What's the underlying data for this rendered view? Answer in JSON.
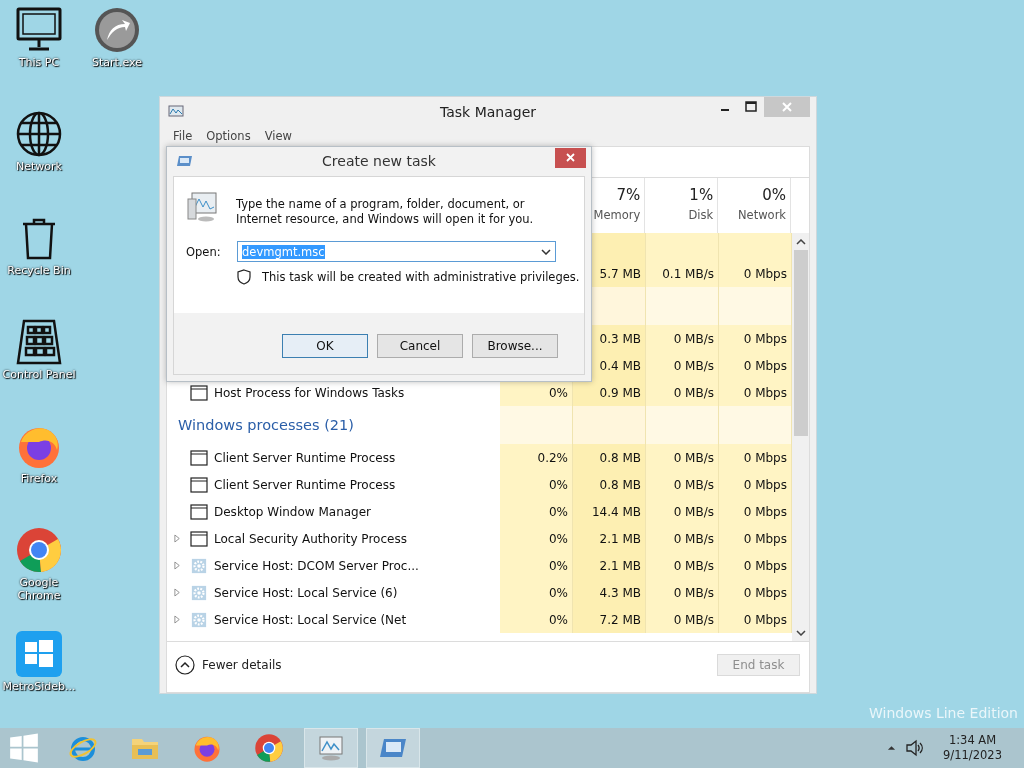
{
  "desktop": {
    "icons": [
      {
        "kind": "monitor",
        "label": "This PC"
      },
      {
        "kind": "globe",
        "label": "Network"
      },
      {
        "kind": "bin",
        "label": "Recycle Bin"
      },
      {
        "kind": "panel",
        "label": "Control Panel"
      },
      {
        "kind": "firefox",
        "label": "Firefox"
      },
      {
        "kind": "chrome",
        "label": "Google Chrome"
      },
      {
        "kind": "tiles",
        "label": "MetroSideb..."
      },
      {
        "kind": "orb",
        "label": "Start.exe"
      }
    ],
    "edition_text": "Windows Line Edition"
  },
  "task_manager": {
    "title": "Task Manager",
    "menu": [
      "File",
      "Options",
      "View"
    ],
    "columns": [
      {
        "percent": "7%",
        "label": "Memory"
      },
      {
        "percent": "1%",
        "label": "Disk"
      },
      {
        "percent": "0%",
        "label": "Network"
      }
    ],
    "rows": [
      {
        "kind": "blank"
      },
      {
        "kind": "blank",
        "memory": "5.7 MB",
        "disk": "0.1 MB/s",
        "network": "0 Mbps"
      },
      {
        "kind": "group"
      },
      {
        "kind": "blank",
        "memory": "0.3 MB",
        "disk": "0 MB/s",
        "network": "0 Mbps"
      },
      {
        "kind": "blank",
        "memory": "0.4 MB",
        "disk": "0 MB/s",
        "network": "0 Mbps"
      },
      {
        "kind": "window",
        "expandable": false,
        "name": "Host Process for Windows Tasks",
        "cpu": "0%",
        "memory": "0.9 MB",
        "disk": "0 MB/s",
        "network": "0 Mbps"
      },
      {
        "kind": "group",
        "name": "Windows processes (21)"
      },
      {
        "kind": "window",
        "expandable": false,
        "name": "Client Server Runtime Process",
        "cpu": "0.2%",
        "memory": "0.8 MB",
        "disk": "0 MB/s",
        "network": "0 Mbps"
      },
      {
        "kind": "window",
        "expandable": false,
        "name": "Client Server Runtime Process",
        "cpu": "0%",
        "memory": "0.8 MB",
        "disk": "0 MB/s",
        "network": "0 Mbps"
      },
      {
        "kind": "window",
        "expandable": false,
        "name": "Desktop Window Manager",
        "cpu": "0%",
        "memory": "14.4 MB",
        "disk": "0 MB/s",
        "network": "0 Mbps"
      },
      {
        "kind": "window",
        "expandable": true,
        "name": "Local Security Authority Process",
        "cpu": "0%",
        "memory": "2.1 MB",
        "disk": "0 MB/s",
        "network": "0 Mbps"
      },
      {
        "kind": "service",
        "expandable": true,
        "name": "Service Host: DCOM Server Proc...",
        "cpu": "0%",
        "memory": "2.1 MB",
        "disk": "0 MB/s",
        "network": "0 Mbps"
      },
      {
        "kind": "service",
        "expandable": true,
        "name": "Service Host: Local Service (6)",
        "cpu": "0%",
        "memory": "4.3 MB",
        "disk": "0 MB/s",
        "network": "0 Mbps"
      },
      {
        "kind": "service",
        "expandable": true,
        "name": "Service Host: Local Service (Net",
        "cpu": "0%",
        "memory": "7.2 MB",
        "disk": "0 MB/s",
        "network": "0 Mbps"
      }
    ],
    "fewer_details": "Fewer details",
    "end_task": {
      "label": "End task",
      "disabled": true
    }
  },
  "dialog": {
    "title": "Create new task",
    "description": "Type the name of a program, folder, document, or Internet resource, and Windows will open it for you.",
    "open_label": "Open:",
    "open_value": "devmgmt.msc",
    "value_selected": true,
    "admin_note": "This task will be created with administrative privileges.",
    "buttons": [
      {
        "label": "OK",
        "selected": true
      },
      {
        "label": "Cancel",
        "selected": false
      },
      {
        "label": "Browse...",
        "selected": false
      }
    ]
  },
  "taskbar": {
    "apps": [
      {
        "kind": "start",
        "selected": false
      },
      {
        "kind": "ie",
        "selected": false
      },
      {
        "kind": "folder",
        "selected": false
      },
      {
        "kind": "firefox",
        "selected": false
      },
      {
        "kind": "chrome",
        "selected": false
      },
      {
        "kind": "taskmgr",
        "selected": true
      },
      {
        "kind": "run",
        "selected": true
      }
    ],
    "time": "1:34 AM",
    "date": "9/11/2023"
  }
}
